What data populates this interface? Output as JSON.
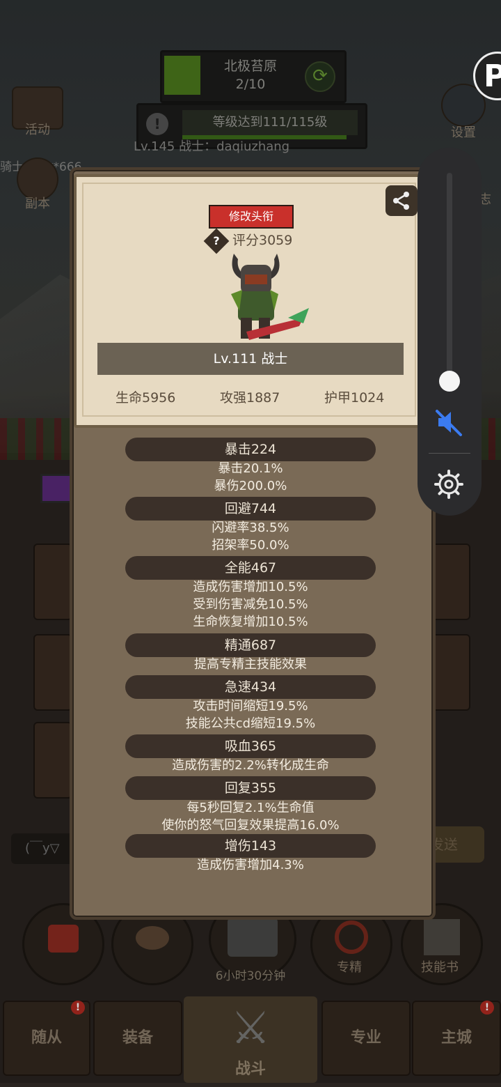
{
  "background": {
    "area": {
      "name": "北极苔原",
      "progress": "2/10"
    },
    "quest": {
      "text": "等级达到111/115级"
    },
    "player_line": "Lv.145 战士：daqiuzhang",
    "knight_line": "骑士：****666",
    "side_left": [
      {
        "label": "活动",
        "icon": "calendar-icon"
      },
      {
        "label": "副本",
        "icon": "portal-icon"
      }
    ],
    "side_right": [
      {
        "label": "设置",
        "icon": "gear-icon"
      },
      {
        "label": "志",
        "icon": "book-icon"
      }
    ],
    "chat_placeholder": "(￣y▽",
    "send_label": "发送",
    "round_buttons": [
      {
        "label": "",
        "icon": "potion-icon"
      },
      {
        "label": "",
        "icon": "bread-icon"
      },
      {
        "label": "",
        "icon": "chest-icon"
      },
      {
        "label": "专精",
        "icon": "spec-icon"
      },
      {
        "label": "技能书",
        "icon": "skillbook-icon"
      }
    ],
    "timer": "6小时30分钟",
    "tabs": [
      {
        "label": "随从",
        "badge": "!"
      },
      {
        "label": "装备",
        "badge": ""
      },
      {
        "label": "战斗",
        "badge": ""
      },
      {
        "label": "专业",
        "badge": ""
      },
      {
        "label": "主城",
        "badge": "!"
      }
    ]
  },
  "card": {
    "title_button": "修改头衔",
    "help_icon": "question-icon",
    "score": "评分3059",
    "share_icon": "share-icon",
    "hero_name": "Lv.111 战士",
    "stats": {
      "hp": "生命5956",
      "atk": "攻强1887",
      "armor": "护甲1024"
    },
    "sections": [
      {
        "header": "暴击224",
        "lines": [
          "暴击20.1%",
          "暴伤200.0%"
        ]
      },
      {
        "header": "回避744",
        "lines": [
          "闪避率38.5%",
          "招架率50.0%"
        ]
      },
      {
        "header": "全能467",
        "lines": [
          "造成伤害增加10.5%",
          "受到伤害减免10.5%",
          "生命恢复增加10.5%"
        ]
      },
      {
        "header": "精通687",
        "lines": [
          "提高专精主技能效果"
        ]
      },
      {
        "header": "急速434",
        "lines": [
          "攻击时间缩短19.5%",
          "技能公共cd缩短19.5%"
        ]
      },
      {
        "header": "吸血365",
        "lines": [
          "造成伤害的2.2%转化成生命"
        ]
      },
      {
        "header": "回复355",
        "lines": [
          "每5秒回复2.1%生命值",
          "使你的怒气回复效果提高16.0%"
        ]
      },
      {
        "header": "增伤143",
        "lines": [
          "造成伤害增加4.3%"
        ]
      }
    ]
  },
  "volume_panel": {
    "level": 0.05,
    "muted": true,
    "mute_icon": "mute-icon",
    "settings_icon": "gear-icon"
  },
  "logo_text": "P",
  "colors": {
    "accent_red": "#c9302b",
    "parchment": "#e7dac2",
    "card_bg": "#7a6a56",
    "mute_blue": "#3b7bf0"
  }
}
